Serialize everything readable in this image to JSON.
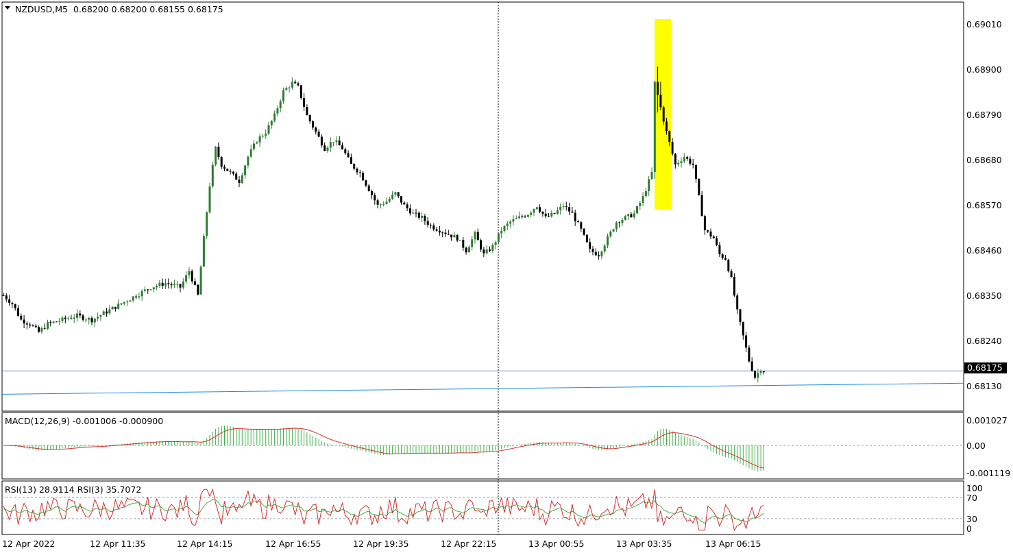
{
  "header": {
    "symbol": "NZDUSD,M5",
    "ohlc": "0.68200 0.68200 0.68155 0.68175"
  },
  "macd": {
    "label": "MACD(12,26,9) -0.001006 -0.000900",
    "scale": [
      "0.001027",
      "0.00",
      "-0.001119"
    ]
  },
  "rsi": {
    "label": "RSI(13) 28.9114  RSI(3) 35.7072",
    "scale": [
      "100",
      "70",
      "30",
      "0"
    ]
  },
  "price_axis": [
    "0.69010",
    "0.68900",
    "0.68790",
    "0.68680",
    "0.68570",
    "0.68460",
    "0.68350",
    "0.68240",
    "0.68130"
  ],
  "current_price": "0.68175",
  "time_axis": [
    "12 Apr 2022",
    "12 Apr 11:35",
    "12 Apr 14:15",
    "12 Apr 16:55",
    "12 Apr 19:35",
    "12 Apr 22:15",
    "13 Apr 00:55",
    "13 Apr 03:35",
    "13 Apr 06:15"
  ],
  "colors": {
    "bull_candle": "#2e7d32",
    "bear_candle": "#000000",
    "highlight": "#ffff00",
    "trend_line": "#1e88e5",
    "macd_hist": "#3cb043",
    "macd_signal": "#d32f2f",
    "rsi_fast": "#d32f2f",
    "rsi_slow": "#3cb043"
  },
  "chart_data": {
    "type": "candlestick",
    "x_labels": [
      "12 Apr 2022",
      "12 Apr 11:35",
      "12 Apr 14:15",
      "12 Apr 16:55",
      "12 Apr 19:35",
      "12 Apr 22:15",
      "13 Apr 00:55",
      "13 Apr 03:35",
      "13 Apr 06:15"
    ],
    "y_range": [
      0.6808,
      0.6907
    ],
    "close_path": [
      [
        0,
        0.6836
      ],
      [
        3,
        0.6834
      ],
      [
        6,
        0.683
      ],
      [
        9,
        0.6829
      ],
      [
        12,
        0.6827
      ],
      [
        15,
        0.6829
      ],
      [
        20,
        0.683
      ],
      [
        25,
        0.6831
      ],
      [
        30,
        0.683
      ],
      [
        35,
        0.6832
      ],
      [
        40,
        0.6834
      ],
      [
        45,
        0.6836
      ],
      [
        50,
        0.6838
      ],
      [
        55,
        0.6839
      ],
      [
        60,
        0.6838
      ],
      [
        63,
        0.6842
      ],
      [
        66,
        0.6836
      ],
      [
        68,
        0.685
      ],
      [
        70,
        0.6863
      ],
      [
        72,
        0.6872
      ],
      [
        74,
        0.6868
      ],
      [
        77,
        0.6866
      ],
      [
        80,
        0.6864
      ],
      [
        83,
        0.687
      ],
      [
        86,
        0.6874
      ],
      [
        89,
        0.6876
      ],
      [
        92,
        0.688
      ],
      [
        95,
        0.6886
      ],
      [
        98,
        0.6888
      ],
      [
        100,
        0.6887
      ],
      [
        103,
        0.688
      ],
      [
        106,
        0.6876
      ],
      [
        109,
        0.6872
      ],
      [
        112,
        0.6874
      ],
      [
        115,
        0.6872
      ],
      [
        118,
        0.6868
      ],
      [
        121,
        0.6866
      ],
      [
        124,
        0.6862
      ],
      [
        127,
        0.6858
      ],
      [
        130,
        0.6859
      ],
      [
        133,
        0.6861
      ],
      [
        136,
        0.6858
      ],
      [
        139,
        0.6856
      ],
      [
        142,
        0.6855
      ],
      [
        145,
        0.6853
      ],
      [
        148,
        0.6852
      ],
      [
        151,
        0.6851
      ],
      [
        154,
        0.685
      ],
      [
        157,
        0.6847
      ],
      [
        160,
        0.6851
      ],
      [
        163,
        0.6846
      ],
      [
        166,
        0.6848
      ],
      [
        169,
        0.6852
      ],
      [
        172,
        0.6854
      ],
      [
        175,
        0.6855
      ],
      [
        178,
        0.6856
      ],
      [
        181,
        0.6858
      ],
      [
        184,
        0.6855
      ],
      [
        187,
        0.6856
      ],
      [
        190,
        0.6858
      ],
      [
        193,
        0.6856
      ],
      [
        196,
        0.6852
      ],
      [
        199,
        0.6847
      ],
      [
        202,
        0.6846
      ],
      [
        205,
        0.685
      ],
      [
        208,
        0.6854
      ],
      [
        211,
        0.6855
      ],
      [
        214,
        0.6856
      ],
      [
        217,
        0.686
      ],
      [
        220,
        0.6866
      ],
      [
        221,
        0.6888
      ],
      [
        223,
        0.6882
      ],
      [
        225,
        0.6876
      ],
      [
        228,
        0.6868
      ],
      [
        231,
        0.687
      ],
      [
        234,
        0.6868
      ],
      [
        236,
        0.686
      ],
      [
        238,
        0.6852
      ],
      [
        241,
        0.685
      ],
      [
        243,
        0.6846
      ],
      [
        245,
        0.6845
      ],
      [
        247,
        0.684
      ],
      [
        249,
        0.6832
      ],
      [
        251,
        0.6826
      ],
      [
        253,
        0.682
      ],
      [
        255,
        0.6816
      ],
      [
        257,
        0.6818
      ],
      [
        258,
        0.68175
      ]
    ],
    "highlight_candles": [
      221,
      222,
      223
    ],
    "hline": 0.68175,
    "trend_line": [
      [
        0,
        0.68118
      ],
      [
        265,
        0.68145
      ]
    ]
  }
}
